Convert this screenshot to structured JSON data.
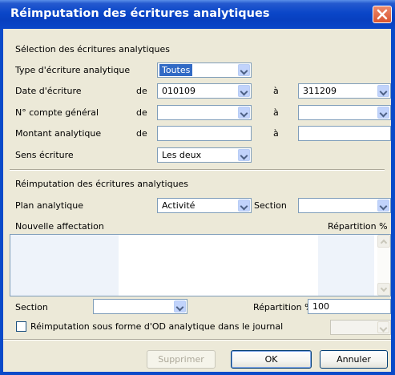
{
  "window": {
    "title": "Réimputation des écritures analytiques",
    "close_icon": "close-x-icon"
  },
  "colors": {
    "titlebar": "#0a46c8",
    "dialog_bg": "#ece9d8",
    "close_button": "#d9542f",
    "selection": "#316ac5"
  },
  "selection": {
    "heading": "Sélection des écritures analytiques",
    "de": "de",
    "a": "à",
    "type": {
      "label": "Type d'écriture analytique",
      "value": "Toutes"
    },
    "date": {
      "label": "Date d'écriture",
      "from": "010109",
      "to": "311209"
    },
    "compte": {
      "label": "N° compte général",
      "from": "",
      "to": ""
    },
    "montant": {
      "label": "Montant analytique",
      "from": "",
      "to": ""
    },
    "sens": {
      "label": "Sens écriture",
      "value": "Les deux"
    }
  },
  "reimputation": {
    "heading": "Réimputation des écritures analytiques",
    "plan": {
      "label": "Plan analytique",
      "value": "Activité"
    },
    "section": {
      "label": "Section",
      "value": ""
    },
    "nouvelle_label": "Nouvelle affectation",
    "repartition_header": "Répartition %",
    "rows": []
  },
  "bottom": {
    "section_label": "Section",
    "section_value": "",
    "repartition_label": "Répartition %",
    "repartition_value": "100",
    "checkbox_label": "Réimputation sous forme d'OD analytique dans le journal",
    "checkbox_checked": false,
    "journal_value": ""
  },
  "buttons": {
    "supprimer": "Supprimer",
    "ok": "OK",
    "annuler": "Annuler"
  }
}
